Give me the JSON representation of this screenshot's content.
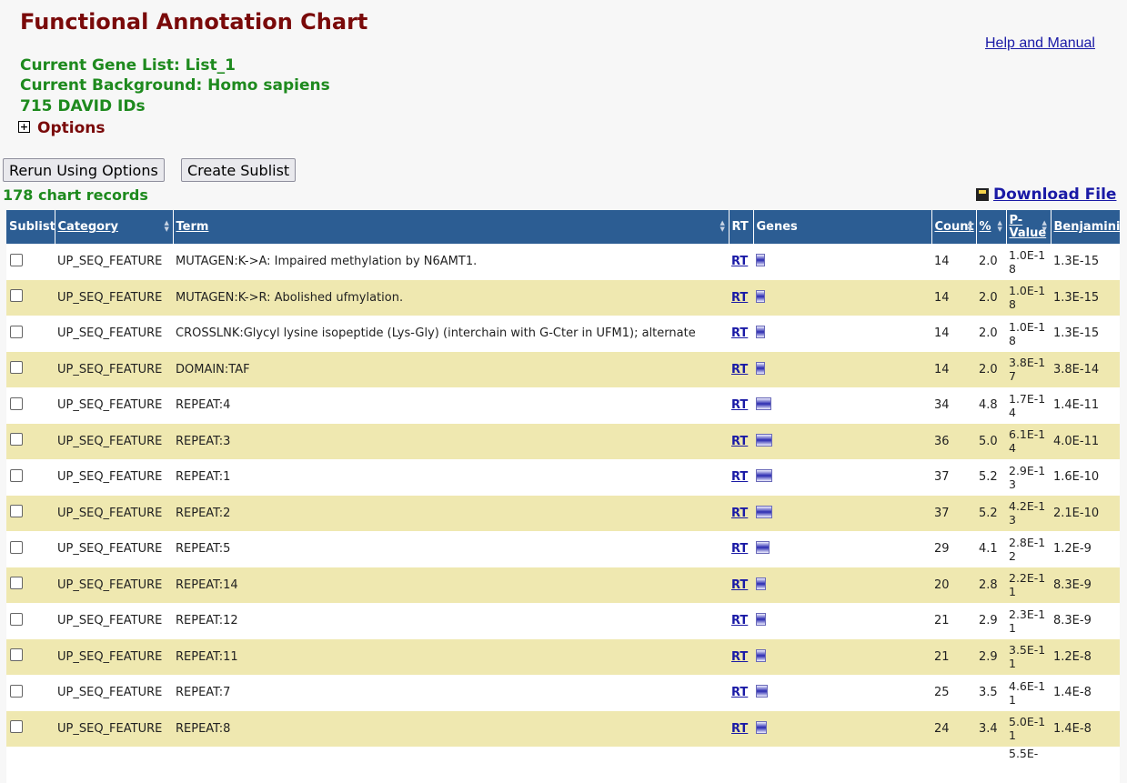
{
  "title": "Functional Annotation Chart",
  "help_link": "Help and Manual",
  "info": {
    "gene_list": "Current Gene List: List_1",
    "background": "Current Background: Homo sapiens",
    "ids": "715 DAVID IDs"
  },
  "options_toggle": "+",
  "options_label": "Options",
  "buttons": {
    "rerun": "Rerun Using Options",
    "sublist": "Create Sublist"
  },
  "records": "178 chart records",
  "download": "Download File",
  "columns": {
    "sublist": "Sublist",
    "category": "Category",
    "term": "Term",
    "rt": "RT",
    "genes": "Genes",
    "count": "Count",
    "pct": "%",
    "pvalue": "P-Value",
    "benjamini": "Benjamini"
  },
  "rows": [
    {
      "category": "UP_SEQ_FEATURE",
      "term": "MUTAGEN:K->A: Impaired methylation by N6AMT1.",
      "rt": "RT",
      "count": "14",
      "pct": "2.0",
      "pvalue": "1.0E-18",
      "benjamini": "1.3E-15",
      "bar": 14
    },
    {
      "category": "UP_SEQ_FEATURE",
      "term": "MUTAGEN:K->R: Abolished ufmylation.",
      "rt": "RT",
      "count": "14",
      "pct": "2.0",
      "pvalue": "1.0E-18",
      "benjamini": "1.3E-15",
      "bar": 14
    },
    {
      "category": "UP_SEQ_FEATURE",
      "term": "CROSSLNK:Glycyl lysine isopeptide (Lys-Gly) (interchain with G-Cter in UFM1); alternate",
      "rt": "RT",
      "count": "14",
      "pct": "2.0",
      "pvalue": "1.0E-18",
      "benjamini": "1.3E-15",
      "bar": 14
    },
    {
      "category": "UP_SEQ_FEATURE",
      "term": "DOMAIN:TAF",
      "rt": "RT",
      "count": "14",
      "pct": "2.0",
      "pvalue": "3.8E-17",
      "benjamini": "3.8E-14",
      "bar": 14
    },
    {
      "category": "UP_SEQ_FEATURE",
      "term": "REPEAT:4",
      "rt": "RT",
      "count": "34",
      "pct": "4.8",
      "pvalue": "1.7E-14",
      "benjamini": "1.4E-11",
      "bar": 34
    },
    {
      "category": "UP_SEQ_FEATURE",
      "term": "REPEAT:3",
      "rt": "RT",
      "count": "36",
      "pct": "5.0",
      "pvalue": "6.1E-14",
      "benjamini": "4.0E-11",
      "bar": 36
    },
    {
      "category": "UP_SEQ_FEATURE",
      "term": "REPEAT:1",
      "rt": "RT",
      "count": "37",
      "pct": "5.2",
      "pvalue": "2.9E-13",
      "benjamini": "1.6E-10",
      "bar": 37
    },
    {
      "category": "UP_SEQ_FEATURE",
      "term": "REPEAT:2",
      "rt": "RT",
      "count": "37",
      "pct": "5.2",
      "pvalue": "4.2E-13",
      "benjamini": "2.1E-10",
      "bar": 37
    },
    {
      "category": "UP_SEQ_FEATURE",
      "term": "REPEAT:5",
      "rt": "RT",
      "count": "29",
      "pct": "4.1",
      "pvalue": "2.8E-12",
      "benjamini": "1.2E-9",
      "bar": 29
    },
    {
      "category": "UP_SEQ_FEATURE",
      "term": "REPEAT:14",
      "rt": "RT",
      "count": "20",
      "pct": "2.8",
      "pvalue": "2.2E-11",
      "benjamini": "8.3E-9",
      "bar": 20
    },
    {
      "category": "UP_SEQ_FEATURE",
      "term": "REPEAT:12",
      "rt": "RT",
      "count": "21",
      "pct": "2.9",
      "pvalue": "2.3E-11",
      "benjamini": "8.3E-9",
      "bar": 21
    },
    {
      "category": "UP_SEQ_FEATURE",
      "term": "REPEAT:11",
      "rt": "RT",
      "count": "21",
      "pct": "2.9",
      "pvalue": "3.5E-11",
      "benjamini": "1.2E-8",
      "bar": 21
    },
    {
      "category": "UP_SEQ_FEATURE",
      "term": "REPEAT:7",
      "rt": "RT",
      "count": "25",
      "pct": "3.5",
      "pvalue": "4.6E-11",
      "benjamini": "1.4E-8",
      "bar": 25
    },
    {
      "category": "UP_SEQ_FEATURE",
      "term": "REPEAT:8",
      "rt": "RT",
      "count": "24",
      "pct": "3.4",
      "pvalue": "5.0E-11",
      "benjamini": "1.4E-8",
      "bar": 24
    }
  ],
  "partial_next_pvalue": "5.5E-",
  "colors": {
    "title": "#7a0a0a",
    "info": "#1e8a1e",
    "header_bg": "#2c5d93",
    "row_alt": "#efe8b0",
    "link": "#1a1aa6"
  }
}
